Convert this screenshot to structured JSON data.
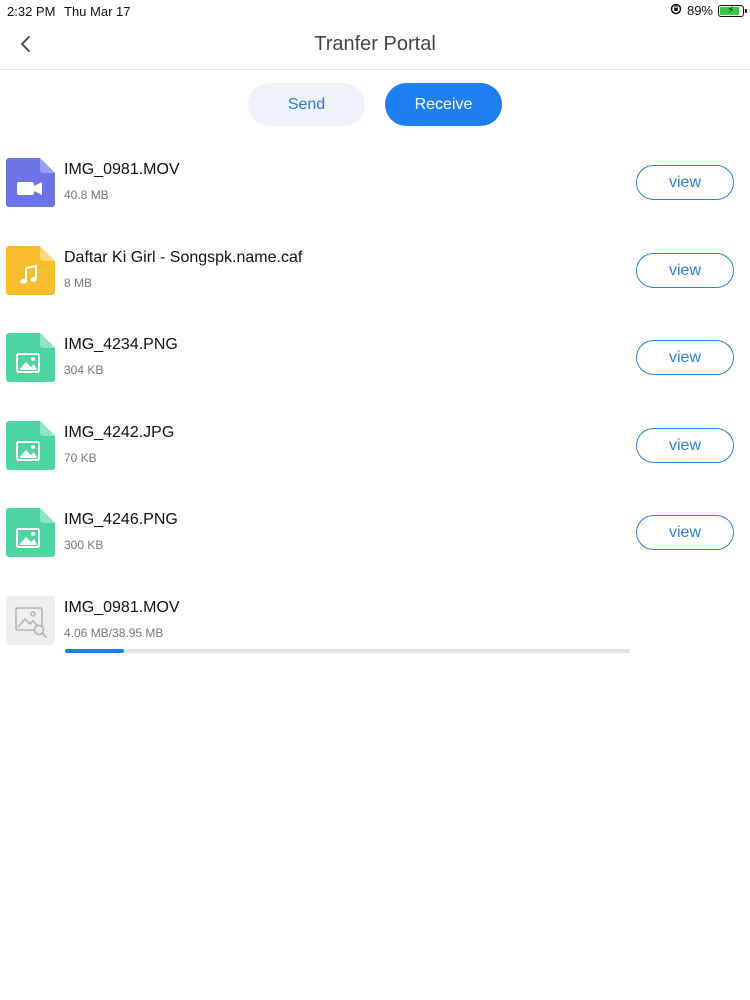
{
  "status_bar": {
    "time": "2:32 PM",
    "date": "Thu Mar 17",
    "battery": "89%",
    "battery_level": 0.89
  },
  "header": {
    "title": "Tranfer Portal",
    "back_icon": "chevron-left-icon"
  },
  "tabs": {
    "send_label": "Send",
    "receive_label": "Receive",
    "active": "Receive",
    "accent_color": "#1e7ff0"
  },
  "files": [
    {
      "name": "IMG_0981.MOV",
      "size": "40.8 MB",
      "type": "video",
      "icon": "video-file-icon",
      "action": "view"
    },
    {
      "name": "Daftar Ki Girl - Songspk.name.caf",
      "size": "8 MB",
      "type": "audio",
      "icon": "audio-file-icon",
      "action": "view"
    },
    {
      "name": "IMG_4234.PNG",
      "size": "304 KB",
      "type": "image",
      "icon": "image-file-icon",
      "action": "view"
    },
    {
      "name": "IMG_4242.JPG",
      "size": "70 KB",
      "type": "image",
      "icon": "image-file-icon",
      "action": "view"
    },
    {
      "name": "IMG_4246.PNG",
      "size": "300 KB",
      "type": "image",
      "icon": "image-file-icon",
      "action": "view"
    }
  ],
  "in_progress": {
    "name": "IMG_0981.MOV",
    "size": "4.06 MB/38.95 MB",
    "icon": "image-placeholder-icon",
    "progress": 0.104
  },
  "colors": {
    "video": "#6b74e6",
    "audio": "#f9be2d",
    "image": "#4dd4a0",
    "placeholder": "#eeeeee"
  }
}
